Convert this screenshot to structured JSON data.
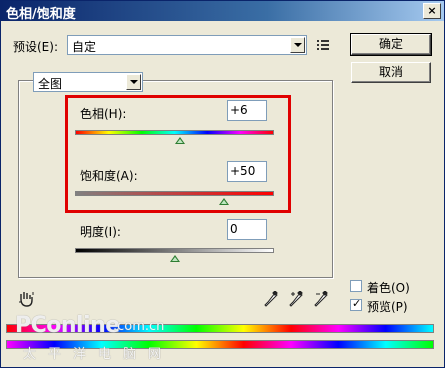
{
  "window": {
    "title": "色相/饱和度",
    "close_glyph": "×"
  },
  "preset": {
    "label": "预设(E):",
    "value": "自定",
    "menu_icon": "list-menu-icon"
  },
  "buttons": {
    "ok": "确定",
    "cancel": "取消"
  },
  "channel": {
    "value": "全图"
  },
  "hue": {
    "label": "色相(H):",
    "value": "+6",
    "slider_fraction": 0.53
  },
  "saturation": {
    "label": "饱和度(A):",
    "value": "+50",
    "slider_fraction": 0.75
  },
  "lightness": {
    "label": "明度(I):",
    "value": "0",
    "slider_fraction": 0.5
  },
  "options": {
    "colorize_label": "着色(O)",
    "colorize_checked": false,
    "preview_label": "预览(P)",
    "preview_checked": true
  },
  "tools": {
    "hand_icon": "hand-adjust-icon",
    "eyedroppers": [
      "eyedropper-icon",
      "eyedropper-plus-icon",
      "eyedropper-minus-icon"
    ]
  },
  "watermark": {
    "brand": "PConline",
    "domain": ".com.cn",
    "chinese": "太平洋电脑网"
  },
  "colors": {
    "highlight_box": "#E00000",
    "title_bar": "#0A246A",
    "dialog_bg": "#ECE9D8"
  }
}
